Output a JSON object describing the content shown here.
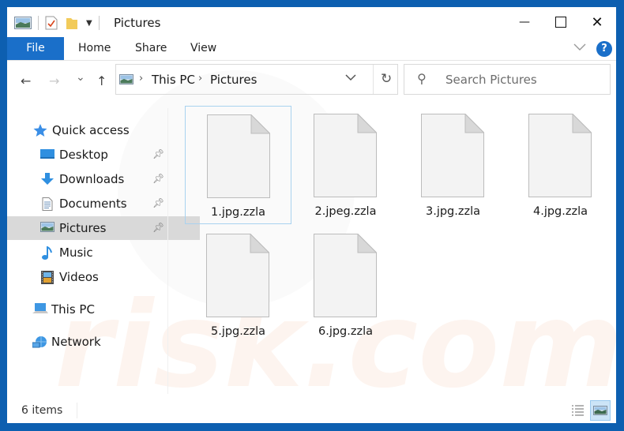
{
  "window": {
    "title": "Pictures",
    "controls": {
      "minimize": "—",
      "maximize": "☐",
      "close": "✕"
    }
  },
  "ribbon": {
    "tabs": [
      {
        "label": "File",
        "active": true
      },
      {
        "label": "Home"
      },
      {
        "label": "Share"
      },
      {
        "label": "View"
      }
    ],
    "help_label": "?"
  },
  "navigation": {
    "back": "←",
    "forward": "→",
    "recent": "⌄",
    "up": "↑",
    "breadcrumb": [
      "This PC",
      "Pictures"
    ],
    "refresh": "↻",
    "search_placeholder": "Search Pictures"
  },
  "sidebar": {
    "items": [
      {
        "label": "Quick access",
        "icon": "star-icon",
        "level": 0
      },
      {
        "label": "Desktop",
        "icon": "desktop-icon",
        "level": 1,
        "pinned": true
      },
      {
        "label": "Downloads",
        "icon": "download-icon",
        "level": 1,
        "pinned": true
      },
      {
        "label": "Documents",
        "icon": "documents-icon",
        "level": 1,
        "pinned": true
      },
      {
        "label": "Pictures",
        "icon": "pictures-icon",
        "level": 1,
        "pinned": true,
        "selected": true
      },
      {
        "label": "Music",
        "icon": "music-icon",
        "level": 1
      },
      {
        "label": "Videos",
        "icon": "videos-icon",
        "level": 1
      },
      {
        "label": "This PC",
        "icon": "computer-icon",
        "level": 0
      },
      {
        "label": "Network",
        "icon": "network-icon",
        "level": 0
      }
    ]
  },
  "files": [
    {
      "name": "1.jpg.zzla",
      "focused": true
    },
    {
      "name": "2.jpeg.zzla"
    },
    {
      "name": "3.jpg.zzla"
    },
    {
      "name": "4.jpg.zzla"
    },
    {
      "name": "5.jpg.zzla"
    },
    {
      "name": "6.jpg.zzla"
    }
  ],
  "status": {
    "item_count": "6 items",
    "view_mode": "large-icons"
  },
  "colors": {
    "accent": "#1a6fc9",
    "frame": "#0d5fb0",
    "selection": "#d9d9d9"
  }
}
